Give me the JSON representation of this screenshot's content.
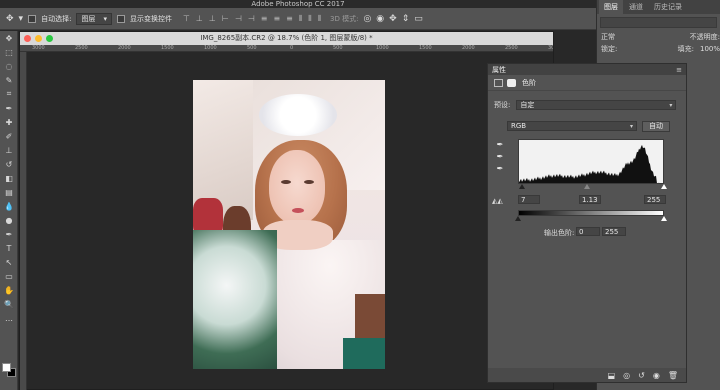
{
  "app": {
    "title": "Adobe Photoshop CC 2017"
  },
  "options": {
    "auto_select_label": "自动选择:",
    "auto_select_value": "图层",
    "show_transform_label": "显示变换控件",
    "mode3d_label": "3D 模式:"
  },
  "right_panel": {
    "tabs": [
      "图层",
      "通道",
      "历史记录"
    ],
    "kind_label": "正常",
    "opacity_label": "不透明度:",
    "opacity_value": "100%",
    "lock_label": "锁定:",
    "fill_label": "填充:",
    "fill_value": "100%"
  },
  "document": {
    "title": "IMG_8265副本.CR2 @ 18.7% (色阶 1, 图层蒙版/8) *",
    "ruler_ticks": [
      "3000",
      "2500",
      "2000",
      "1500",
      "1000",
      "500",
      "0",
      "500",
      "1000",
      "1500",
      "2000",
      "2500",
      "3000"
    ]
  },
  "properties": {
    "tab_label": "属性",
    "title": "色阶",
    "preset_label": "预设:",
    "preset_value": "自定",
    "channel_value": "RGB",
    "auto_button": "自动",
    "input_black": "7",
    "input_gamma": "1.13",
    "input_white": "255",
    "output_label": "输出色阶:",
    "output_black": "0",
    "output_white": "255"
  },
  "levels": {
    "input_black": 7,
    "input_gamma": 1.13,
    "input_white": 255,
    "output_black": 0,
    "output_white": 255
  },
  "icons": {
    "move": "move-icon",
    "eyedropper": "eyedropper-icon"
  },
  "colors": {
    "panel_bg": "#535353",
    "workspace_bg": "#282828",
    "title_bar": "#d9d9d9"
  }
}
